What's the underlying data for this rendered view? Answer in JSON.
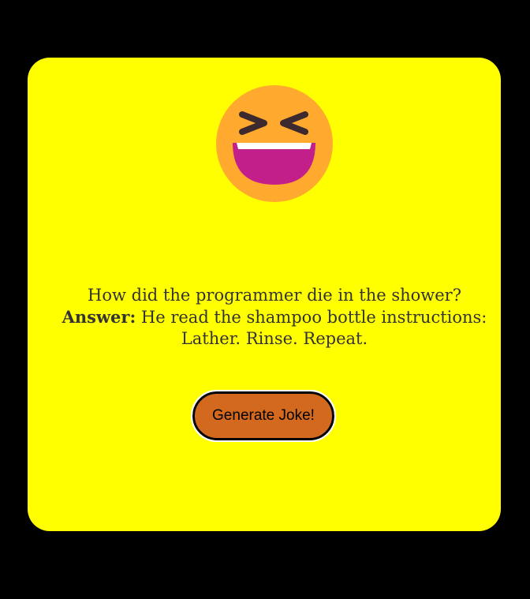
{
  "emoji": {
    "icon": "grinning-squinting-face-icon",
    "colors": {
      "face": "#ffa92f",
      "eyes": "#3d2a2e",
      "mouth": "#c21f8a",
      "teeth": "#ffffff"
    }
  },
  "joke": {
    "question": "How did the programmer die in the shower?",
    "answer_label": "Answer:",
    "answer_text": " He read the shampoo bottle instructions: Lather. Rinse. Repeat."
  },
  "button": {
    "label": "Generate Joke!"
  },
  "colors": {
    "page_background": "#000000",
    "card_background": "#ffff00",
    "button_background": "#d2691e",
    "text": "#333333"
  }
}
